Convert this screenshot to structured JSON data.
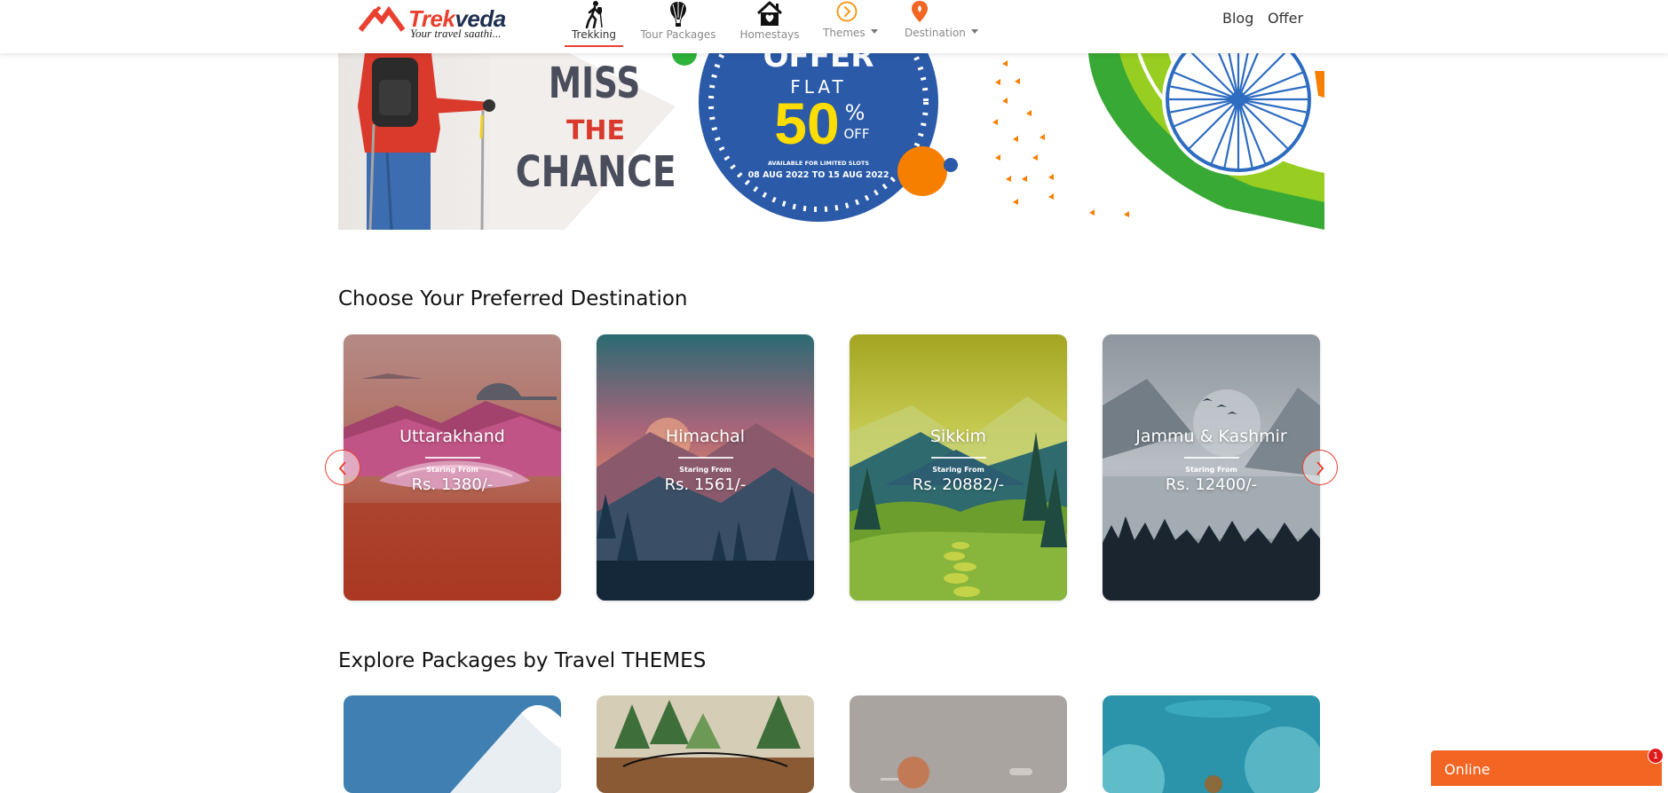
{
  "brand": {
    "name_part1": "Trek",
    "name_part2": "veda",
    "tagline": "Your travel saathi..."
  },
  "nav": {
    "items": [
      {
        "label": "Trekking",
        "icon": "hiker-icon",
        "active": true
      },
      {
        "label": "Tour Packages",
        "icon": "hot-air-balloon-icon",
        "active": false
      },
      {
        "label": "Homestays",
        "icon": "house-heart-icon",
        "active": false
      },
      {
        "label": "Themes",
        "icon": "chevron-circle-icon",
        "active": false
      },
      {
        "label": "Destination",
        "icon": "location-pin-icon",
        "active": false
      }
    ],
    "right_links": [
      "Blog",
      "Offer"
    ]
  },
  "banner": {
    "miss": "MISS",
    "the": "THE",
    "chance": "CHANCE",
    "offer_word": "OFFER",
    "flat": "FLAT",
    "discount": "50",
    "percent": "%",
    "off": "OFF",
    "availability": "AVAILABLE FOR LIMITED SLOTS",
    "dates": "08 AUG 2022 TO 15 AUG 2022"
  },
  "destinations": {
    "title": "Choose Your Preferred Destination",
    "starting_label": "Staring From",
    "items": [
      {
        "name": "Uttarakhand",
        "price": "Rs. 1380/-"
      },
      {
        "name": "Himachal",
        "price": "Rs. 1561/-"
      },
      {
        "name": "Sikkim",
        "price": "Rs. 20882/-"
      },
      {
        "name": "Jammu & Kashmir",
        "price": "Rs. 12400/-"
      }
    ]
  },
  "themes": {
    "title": "Explore Packages by Travel THEMES"
  },
  "chat": {
    "label": "Online",
    "badge": "1"
  },
  "colors": {
    "brand_red": "#e8412f",
    "brand_navy": "#1f2f4f",
    "chat_orange": "#f26522",
    "offer_blue": "#2a5aa8",
    "offer_yellow": "#ffdd00"
  }
}
